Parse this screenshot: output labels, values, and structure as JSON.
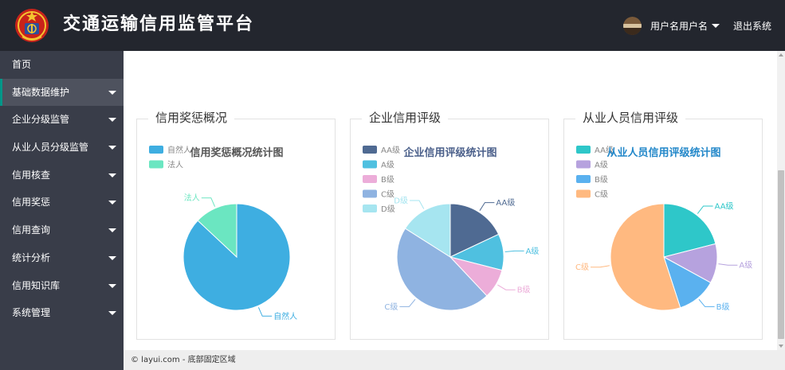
{
  "header": {
    "title": "交通运输信用监管平台",
    "user_name": "用户名用户名",
    "logout_label": "退出系统"
  },
  "sidebar": {
    "items": [
      {
        "label": "首页",
        "has_submenu": false,
        "active": false
      },
      {
        "label": "基础数据维护",
        "has_submenu": true,
        "active": true
      },
      {
        "label": "企业分级监管",
        "has_submenu": true,
        "active": false
      },
      {
        "label": "从业人员分级监管",
        "has_submenu": true,
        "active": false
      },
      {
        "label": "信用核查",
        "has_submenu": true,
        "active": false
      },
      {
        "label": "信用奖惩",
        "has_submenu": true,
        "active": false
      },
      {
        "label": "信用查询",
        "has_submenu": true,
        "active": false
      },
      {
        "label": "统计分析",
        "has_submenu": true,
        "active": false
      },
      {
        "label": "信用知识库",
        "has_submenu": true,
        "active": false
      },
      {
        "label": "系统管理",
        "has_submenu": true,
        "active": false
      }
    ]
  },
  "cards": [
    {
      "title": "信用奖惩概况"
    },
    {
      "title": "企业信用评级"
    },
    {
      "title": "从业人员信用评级"
    }
  ],
  "chart_data": [
    {
      "type": "pie",
      "title": "信用奖惩概况统计图",
      "title_color": "#555555",
      "categories": [
        "自然人",
        "法人"
      ],
      "values": [
        87,
        13
      ],
      "colors": [
        "#3eaee1",
        "#6be6c1"
      ],
      "legend_labels": [
        "自然人",
        "法人"
      ],
      "legend_position": "top-left"
    },
    {
      "type": "pie",
      "title": "企业信用评级统计图",
      "title_color": "#4a5f8a",
      "categories": [
        "AA级",
        "A级",
        "B级",
        "C级",
        "D级"
      ],
      "values": [
        18,
        11,
        9,
        46,
        16
      ],
      "colors": [
        "#4f6a92",
        "#4fc0e0",
        "#ecadd9",
        "#8fb3e1",
        "#a6e5f0"
      ],
      "legend_labels": [
        "AA级",
        "A级",
        "B级",
        "C级",
        "D级"
      ],
      "legend_position": "top-left"
    },
    {
      "type": "pie",
      "title": "从业人员信用评级统计图",
      "title_color": "#2287c9",
      "categories": [
        "AA级",
        "A级",
        "B级",
        "C级"
      ],
      "values": [
        21,
        12,
        12,
        55
      ],
      "colors": [
        "#2ec7c9",
        "#b6a2de",
        "#5ab1ef",
        "#ffb980"
      ],
      "legend_labels": [
        "AA级",
        "A级",
        "B级",
        "C级"
      ],
      "legend_position": "top-left"
    }
  ],
  "footer": {
    "text": "© layui.com - 底部固定区域"
  }
}
